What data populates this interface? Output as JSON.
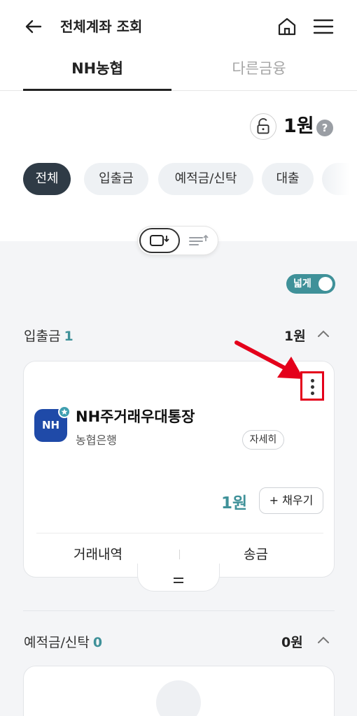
{
  "header": {
    "title": "전체계좌 조회",
    "icons": {
      "back": "back-arrow-icon",
      "home": "home-icon",
      "menu": "hamburger-menu-icon"
    }
  },
  "tabs": [
    {
      "label": "NH농협",
      "active": true
    },
    {
      "label": "다른금융",
      "active": false
    }
  ],
  "summary": {
    "total": "1원",
    "help": "?",
    "lock_icon": "unlock-icon"
  },
  "filters": [
    {
      "label": "전체",
      "active": true
    },
    {
      "label": "입출금",
      "active": false
    },
    {
      "label": "예적금/신탁",
      "active": false
    },
    {
      "label": "대출",
      "active": false
    }
  ],
  "view_toggle": {
    "selected_icon": "card-view-icon",
    "other_icon": "list-sort-icon"
  },
  "wide_toggle": {
    "label": "넓게",
    "on": true
  },
  "sections": [
    {
      "title": "입출금",
      "count": "1",
      "amount": "1원",
      "expanded": true
    },
    {
      "title": "예적금/신탁",
      "count": "0",
      "amount": "0원",
      "expanded": true
    }
  ],
  "account": {
    "logo_text": "NH",
    "name": "NH주거래우대통장",
    "bank": "농협은행",
    "detail_label": "자세히",
    "balance": "1원",
    "fill_label": "+ 채우기",
    "actions": [
      "거래내역",
      "송금"
    ],
    "more_icon": "more-vertical-icon"
  },
  "colors": {
    "accent": "#3f9199",
    "dark_chip": "#2f3b46",
    "annotation": "#e4001b",
    "nh_blue": "#1f4aa8"
  }
}
